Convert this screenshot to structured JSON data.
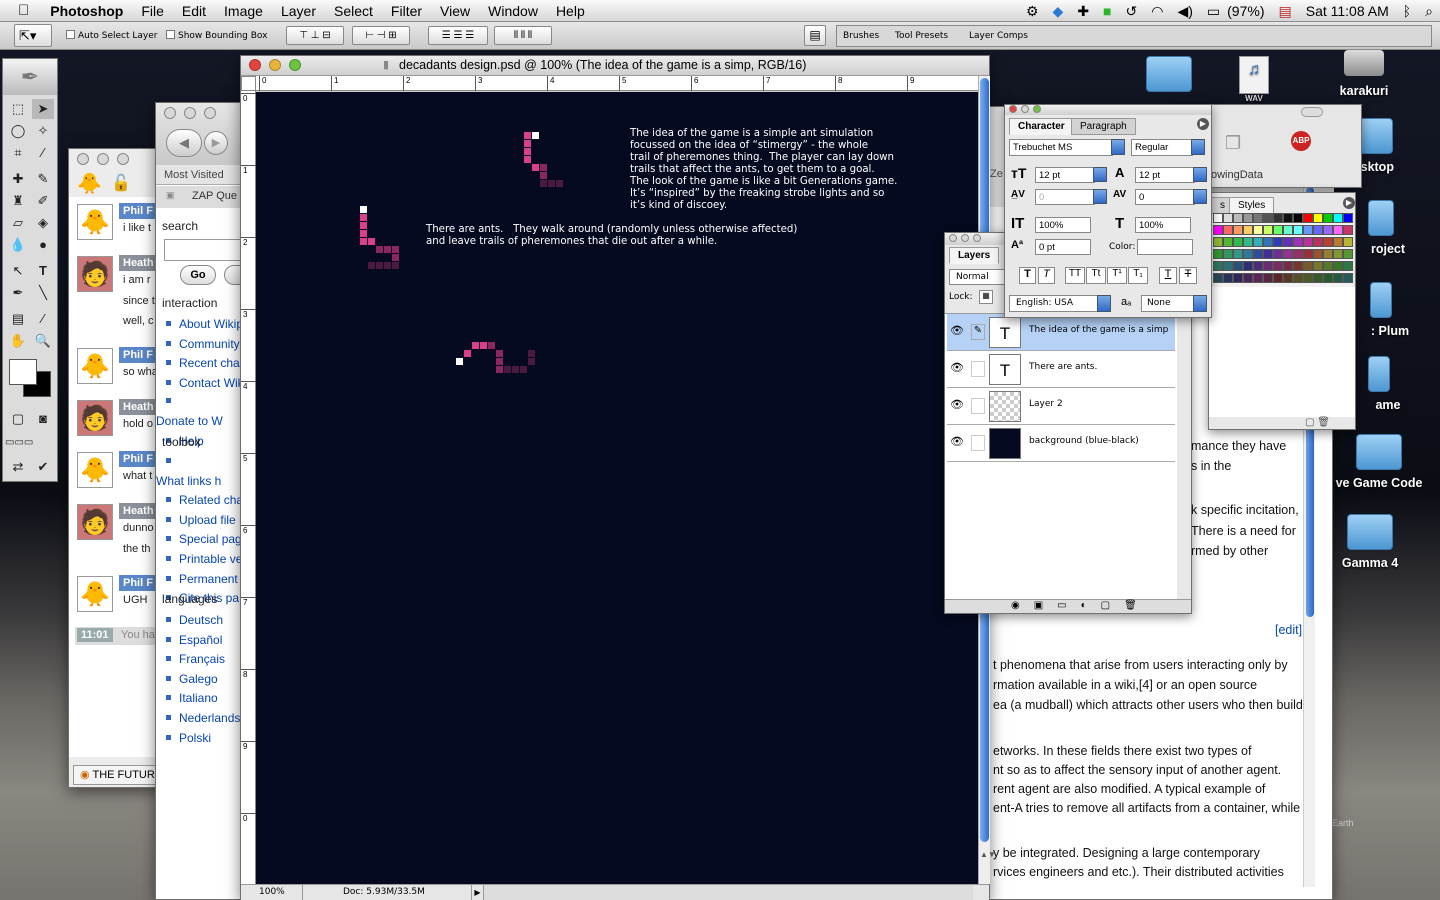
{
  "menubar": {
    "app_name": "Photoshop",
    "items": [
      "File",
      "Edit",
      "Image",
      "Layer",
      "Select",
      "Filter",
      "View",
      "Window",
      "Help"
    ],
    "battery": "(97%)",
    "clock": "Sat 11:08 AM"
  },
  "options_bar": {
    "auto_select_label": "Auto Select Layer",
    "bounding_box_label": "Show Bounding Box",
    "palette_well_tabs": [
      "Brushes",
      "Tool Presets",
      "Layer Comps"
    ]
  },
  "chat": {
    "rows": [
      {
        "name": "Phil F",
        "msg": "i like t",
        "avatar": "🐥"
      },
      {
        "name": "Heath",
        "msg": "i am r",
        "avatar": "🧑"
      },
      {
        "name": "",
        "msg": "since t",
        "avatar": ""
      },
      {
        "name": "",
        "msg": "well, c",
        "avatar": ""
      },
      {
        "name": "Phil F",
        "msg": "so wha",
        "avatar": "🐥"
      },
      {
        "name": "Heath",
        "msg": "hold o",
        "avatar": "🧑"
      },
      {
        "name": "Phil F",
        "msg": "what t",
        "avatar": "🐥"
      },
      {
        "name": "Heath",
        "msg": "dunno",
        "avatar": "🧑"
      },
      {
        "name": "",
        "msg": "the th",
        "avatar": ""
      },
      {
        "name": "Phil F",
        "msg": "UGH",
        "avatar": "🐥"
      }
    ],
    "time": "11:01",
    "you_prefix": "You ha",
    "bottom_tab": "THE FUTUR"
  },
  "browser": {
    "most_visited": "Most Visited",
    "zap": "ZAP Que",
    "search_heading": "search",
    "go_button": "Go",
    "interaction_heading": "interaction",
    "interaction_links": [
      "About Wikip",
      "Community",
      "Recent char",
      "Contact Wik",
      "Donate to W",
      "Help"
    ],
    "toolbox_heading": "toolbox",
    "toolbox_links": [
      "What links h",
      "Related cha",
      "Upload file",
      "Special pag",
      "Printable ve",
      "Permanent",
      "Cite this pa"
    ],
    "languages_heading": "languages",
    "language_links": [
      "Deutsch",
      "Español",
      "Français",
      "Galego",
      "Italiano",
      "Nederlands",
      "Polski"
    ]
  },
  "document": {
    "title": "decadants design.psd @ 100% (The idea of the game is a simp, RGB/16)",
    "ruler_top": [
      "0",
      "1",
      "2",
      "3",
      "4",
      "5",
      "6",
      "7",
      "8",
      "9"
    ],
    "ruler_left": [
      "0",
      "1",
      "2",
      "3",
      "4",
      "5",
      "6",
      "7",
      "8",
      "9",
      "0"
    ],
    "zoom": "100%",
    "doc_size": "Doc: 5.93M/33.5M",
    "text_block_1": "The idea of the game is a simple ant simulation\nfocussed on the idea of “stimergy” - the whole\ntrail of pheremones thing.  The player can lay down\ntrails that affect the ants, to get them to a goal.\nThe look of the game is like a bit Generations game.\nIt’s “inspired” by the freaking strobe lights and so\nit’s kind of discoey.",
    "text_block_2": "There are ants.   They walk around (randomly unless otherwise affected)\nand leave trails of pheremones that die out after a while."
  },
  "character_panel": {
    "tabs": [
      "Character",
      "Paragraph"
    ],
    "font_family": "Trebuchet MS",
    "font_style": "Regular",
    "font_size": "12 pt",
    "leading": "12 pt",
    "kerning": "0",
    "tracking": "0",
    "vertical_scale": "100%",
    "horizontal_scale": "100%",
    "baseline_shift": "0 pt",
    "color_label": "Color:",
    "language": "English: USA",
    "antialias_symbol": "aₐ",
    "antialias": "None",
    "style_buttons": [
      "T",
      "T",
      "TT",
      "Tt",
      "T¹",
      "T₁",
      "T",
      "T"
    ]
  },
  "layers_panel": {
    "tab": "Layers",
    "blend_mode": "Normal",
    "lock_label": "Lock:",
    "layers": [
      {
        "name": "The idea of the game is a simp",
        "type": "text",
        "selected": true
      },
      {
        "name": "There are ants.",
        "type": "text",
        "selected": false
      },
      {
        "name": "Layer 2",
        "type": "raster",
        "selected": false
      },
      {
        "name": "background (blue-black)",
        "type": "fill",
        "selected": false
      }
    ]
  },
  "swatches_panel": {
    "tabs": [
      "s",
      "Styles"
    ]
  },
  "behind_panel": {
    "text_1": "Ze",
    "text_2": "owingData"
  },
  "wiki": {
    "lines": [
      "mance they have",
      "s in the",
      "k specific incitation,",
      "There is a need for",
      "rmed by other",
      "[edit]",
      "t phenomena that arise from users interacting only by",
      "rmation available in a wiki,[4] or an open source",
      "ea (a mudball) which attracts other users who then build",
      "etworks. In these fields there exist two types of",
      "nt so as to affect the sensory input of another agent.",
      "rent agent are also modified. A typical example of",
      "ent-A tries to remove all artifacts from a container, while",
      "y be integrated. Designing a large contemporary",
      "rvices engineers and etc.). Their distributed activities"
    ]
  },
  "desktop_icons": [
    {
      "label": "karakuri"
    },
    {
      "label": "desktop"
    },
    {
      "label": "roject"
    },
    {
      "label": ": Plum"
    },
    {
      "label": "ame"
    },
    {
      "label": "ve Game Code"
    },
    {
      "label": "Gamma 4"
    }
  ],
  "wav_label": "WAV",
  "earth_label": "Earth",
  "colors": {
    "canvas_bg": "#060a20",
    "ant_pink": "#d8408a",
    "trail_mid": "#8a2660",
    "trail_dark": "#4a1a40",
    "selection": "#b5d1f5"
  }
}
